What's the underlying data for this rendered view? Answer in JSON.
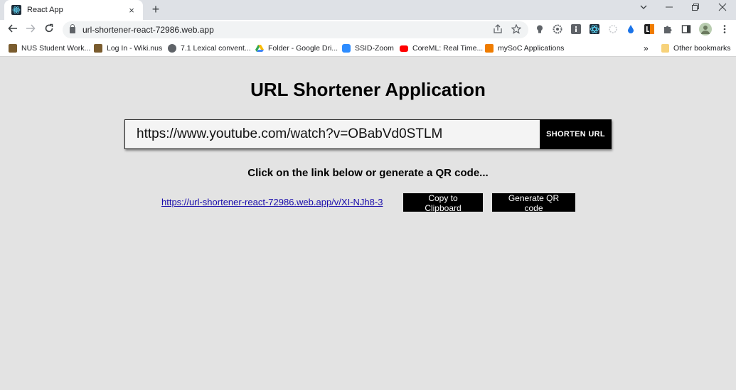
{
  "browser": {
    "tab_title": "React App",
    "url": "url-shortener-react-72986.web.app",
    "new_tab_symbol": "+",
    "close_tab_symbol": "×",
    "bookmarks": [
      {
        "label": "NUS Student Work...",
        "icon": "nus-crest-icon",
        "color": "#7a5c2e"
      },
      {
        "label": "Log In - Wiki.nus",
        "icon": "nus-crest-icon",
        "color": "#7a5c2e"
      },
      {
        "label": "7.1  Lexical convent...",
        "icon": "globe-icon",
        "color": "#5f6368"
      },
      {
        "label": "Folder - Google Dri...",
        "icon": "google-drive-icon",
        "color": "#34a853"
      },
      {
        "label": "SSID-Zoom",
        "icon": "zoom-icon",
        "color": "#2d8cff"
      },
      {
        "label": "CoreML: Real Time...",
        "icon": "youtube-icon",
        "color": "#ff0000"
      },
      {
        "label": "mySoC Applications",
        "icon": "nus-icon",
        "color": "#ef7c00"
      }
    ],
    "bookmarks_overflow": "»",
    "other_bookmarks": "Other bookmarks"
  },
  "app": {
    "title": "URL Shortener Application",
    "input_value": "https://www.youtube.com/watch?v=OBabVd0STLM",
    "shorten_label": "SHORTEN URL",
    "instruction": "Click on the link below or generate a QR code...",
    "short_url": "https://url-shortener-react-72986.web.app/v/XI-NJh8-3",
    "copy_label": "Copy to Clipboard",
    "qr_label": "Generate QR code"
  }
}
